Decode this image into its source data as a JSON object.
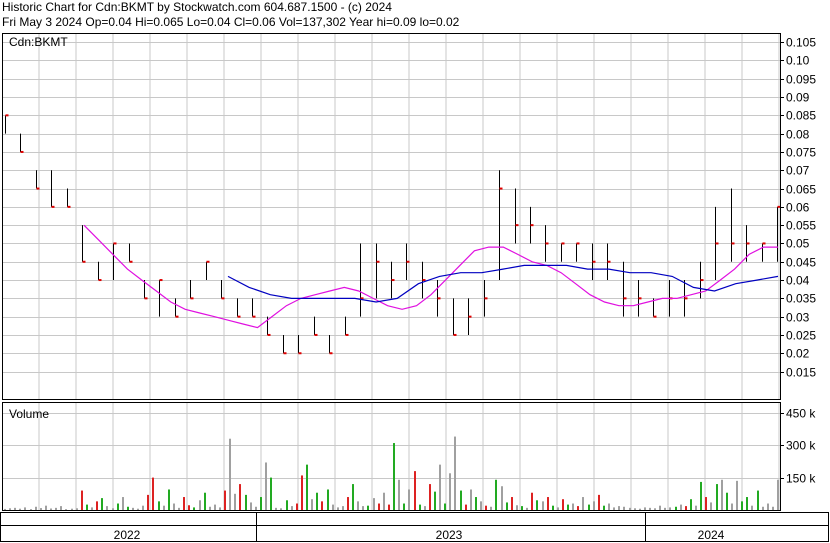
{
  "header": {
    "line1": "Historic Chart for Cdn:BKMT by Stockwatch.com 604.687.1500 - (c) 2024",
    "line2": "Fri May  3 2024   Op=0.04  Hi=0.065  Lo=0.04  Cl=0.06  Vol=137,302  Year hi=0.09  lo=0.02"
  },
  "chart_data": [
    {
      "type": "ohlc",
      "title": "Cdn:BKMT",
      "ylim": [
        0.0075,
        0.1075
      ],
      "y_ticks": [
        0.015,
        0.02,
        0.025,
        0.03,
        0.035,
        0.04,
        0.045,
        0.05,
        0.055,
        0.06,
        0.065,
        0.07,
        0.075,
        0.08,
        0.085,
        0.09,
        0.095,
        0.1,
        0.105
      ],
      "y_tick_labels": [
        "0.015",
        "0.02",
        "0.025",
        "0.03",
        "0.035",
        "0.04",
        "0.045",
        "0.05",
        "0.055",
        "0.06",
        "0.065",
        "0.07",
        "0.075",
        "0.08",
        "0.085",
        "0.09",
        "0.095",
        "0.10",
        "0.105"
      ],
      "grid": true,
      "colors": {
        "price_bar": "#000000",
        "close_tick": "#e00000",
        "ma_short": "#e010e0",
        "ma_long": "#0000c0",
        "grid": "#c8c8c8"
      },
      "bars_dense": [
        [
          0.08,
          0.085,
          0.08,
          0.085
        ],
        [
          0.08,
          0.08,
          0.075,
          0.075
        ],
        [
          0.07,
          0.07,
          0.065,
          0.065
        ],
        [
          0.07,
          0.07,
          0.06,
          0.06
        ],
        [
          0.065,
          0.065,
          0.06,
          0.06
        ],
        [
          0.06,
          0.065,
          0.06,
          0.06
        ],
        [
          0.055,
          0.055,
          0.045,
          0.045
        ],
        [
          0.045,
          0.045,
          0.04,
          0.04
        ],
        [
          0.04,
          0.05,
          0.04,
          0.05
        ],
        [
          0.05,
          0.05,
          0.045,
          0.045
        ],
        [
          0.04,
          0.04,
          0.035,
          0.035
        ],
        [
          0.035,
          0.04,
          0.03,
          0.04
        ],
        [
          0.03,
          0.035,
          0.03,
          0.03
        ],
        [
          0.035,
          0.04,
          0.035,
          0.035
        ],
        [
          0.04,
          0.045,
          0.04,
          0.045
        ],
        [
          0.04,
          0.04,
          0.035,
          0.035
        ],
        [
          0.035,
          0.035,
          0.03,
          0.03
        ],
        [
          0.03,
          0.035,
          0.03,
          0.03
        ],
        [
          0.03,
          0.03,
          0.025,
          0.025
        ],
        [
          0.02,
          0.025,
          0.02,
          0.02
        ],
        [
          0.025,
          0.025,
          0.02,
          0.02
        ],
        [
          0.025,
          0.03,
          0.025,
          0.025
        ],
        [
          0.02,
          0.025,
          0.02,
          0.02
        ],
        [
          0.025,
          0.03,
          0.025,
          0.025
        ],
        [
          0.03,
          0.05,
          0.03,
          0.035
        ],
        [
          0.04,
          0.05,
          0.035,
          0.045
        ],
        [
          0.04,
          0.045,
          0.035,
          0.04
        ],
        [
          0.045,
          0.05,
          0.04,
          0.045
        ],
        [
          0.04,
          0.045,
          0.035,
          0.04
        ],
        [
          0.035,
          0.04,
          0.03,
          0.035
        ],
        [
          0.03,
          0.035,
          0.025,
          0.025
        ],
        [
          0.03,
          0.035,
          0.025,
          0.03
        ],
        [
          0.035,
          0.04,
          0.03,
          0.035
        ],
        [
          0.04,
          0.07,
          0.04,
          0.065
        ],
        [
          0.06,
          0.065,
          0.05,
          0.055
        ],
        [
          0.055,
          0.06,
          0.05,
          0.055
        ],
        [
          0.05,
          0.055,
          0.045,
          0.05
        ],
        [
          0.045,
          0.05,
          0.045,
          0.05
        ],
        [
          0.05,
          0.05,
          0.045,
          0.05
        ],
        [
          0.045,
          0.05,
          0.04,
          0.045
        ],
        [
          0.045,
          0.05,
          0.04,
          0.045
        ],
        [
          0.04,
          0.045,
          0.03,
          0.035
        ],
        [
          0.035,
          0.04,
          0.03,
          0.035
        ],
        [
          0.03,
          0.035,
          0.03,
          0.03
        ],
        [
          0.035,
          0.04,
          0.03,
          0.035
        ],
        [
          0.035,
          0.04,
          0.03,
          0.035
        ],
        [
          0.04,
          0.045,
          0.035,
          0.04
        ],
        [
          0.045,
          0.06,
          0.04,
          0.05
        ],
        [
          0.05,
          0.065,
          0.045,
          0.05
        ],
        [
          0.05,
          0.055,
          0.045,
          0.05
        ],
        [
          0.045,
          0.05,
          0.045,
          0.05
        ],
        [
          0.05,
          0.06,
          0.045,
          0.06
        ]
      ],
      "bars": [
        [
          0.08,
          0.085,
          0.08,
          0.085
        ],
        [
          0.08,
          0.08,
          0.075,
          0.075
        ],
        [
          0.07,
          0.07,
          0.065,
          0.065
        ],
        [
          0.07,
          0.07,
          0.06,
          0.06
        ],
        [
          0.065,
          0.065,
          0.06,
          0.06
        ],
        [
          0.055,
          0.055,
          0.045,
          0.045
        ],
        [
          0.045,
          0.045,
          0.04,
          0.04
        ],
        [
          0.04,
          0.05,
          0.04,
          0.05
        ],
        [
          0.05,
          0.05,
          0.045,
          0.045
        ],
        [
          0.04,
          0.04,
          0.035,
          0.035
        ],
        [
          0.035,
          0.04,
          0.03,
          0.04
        ],
        [
          0.03,
          0.035,
          0.03,
          0.03
        ],
        [
          0.035,
          0.04,
          0.035,
          0.035
        ],
        [
          0.04,
          0.045,
          0.04,
          0.045
        ],
        [
          0.04,
          0.04,
          0.035,
          0.035
        ],
        [
          0.035,
          0.035,
          0.03,
          0.03
        ],
        [
          0.03,
          0.035,
          0.03,
          0.03
        ],
        [
          0.03,
          0.03,
          0.025,
          0.025
        ],
        [
          0.02,
          0.025,
          0.02,
          0.02
        ],
        [
          0.025,
          0.025,
          0.02,
          0.02
        ],
        [
          0.025,
          0.03,
          0.025,
          0.025
        ],
        [
          0.02,
          0.025,
          0.02,
          0.02
        ],
        [
          0.025,
          0.03,
          0.025,
          0.025
        ],
        [
          0.03,
          0.05,
          0.03,
          0.035
        ],
        [
          0.04,
          0.05,
          0.035,
          0.045
        ],
        [
          0.04,
          0.045,
          0.035,
          0.04
        ],
        [
          0.045,
          0.05,
          0.04,
          0.045
        ],
        [
          0.04,
          0.045,
          0.035,
          0.04
        ],
        [
          0.035,
          0.04,
          0.03,
          0.035
        ],
        [
          0.03,
          0.035,
          0.025,
          0.025
        ],
        [
          0.03,
          0.035,
          0.025,
          0.03
        ],
        [
          0.035,
          0.04,
          0.03,
          0.035
        ],
        [
          0.04,
          0.07,
          0.04,
          0.065
        ],
        [
          0.06,
          0.065,
          0.05,
          0.055
        ],
        [
          0.055,
          0.06,
          0.05,
          0.055
        ],
        [
          0.05,
          0.055,
          0.045,
          0.05
        ],
        [
          0.045,
          0.05,
          0.045,
          0.05
        ],
        [
          0.05,
          0.05,
          0.045,
          0.05
        ],
        [
          0.045,
          0.05,
          0.04,
          0.045
        ],
        [
          0.045,
          0.05,
          0.04,
          0.045
        ],
        [
          0.04,
          0.045,
          0.03,
          0.035
        ],
        [
          0.035,
          0.04,
          0.03,
          0.035
        ],
        [
          0.03,
          0.035,
          0.03,
          0.03
        ],
        [
          0.035,
          0.04,
          0.03,
          0.035
        ],
        [
          0.035,
          0.04,
          0.03,
          0.035
        ],
        [
          0.04,
          0.045,
          0.035,
          0.04
        ],
        [
          0.045,
          0.06,
          0.04,
          0.05
        ],
        [
          0.05,
          0.065,
          0.045,
          0.05
        ],
        [
          0.05,
          0.055,
          0.045,
          0.05
        ],
        [
          0.045,
          0.05,
          0.045,
          0.05
        ],
        [
          0.05,
          0.06,
          0.045,
          0.06
        ]
      ],
      "ma_short": [
        0.055,
        0.051,
        0.047,
        0.043,
        0.04,
        0.037,
        0.034,
        0.032,
        0.031,
        0.03,
        0.029,
        0.028,
        0.027,
        0.03,
        0.033,
        0.035,
        0.036,
        0.037,
        0.038,
        0.037,
        0.035,
        0.033,
        0.032,
        0.033,
        0.036,
        0.04,
        0.044,
        0.048,
        0.049,
        0.049,
        0.047,
        0.045,
        0.044,
        0.042,
        0.039,
        0.036,
        0.034,
        0.033,
        0.033,
        0.034,
        0.035,
        0.035,
        0.036,
        0.037,
        0.04,
        0.043,
        0.047,
        0.049,
        0.049
      ],
      "ma_long": [
        0.041,
        0.038,
        0.036,
        0.035,
        0.035,
        0.035,
        0.035,
        0.034,
        0.035,
        0.039,
        0.041,
        0.042,
        0.042,
        0.043,
        0.044,
        0.044,
        0.044,
        0.043,
        0.043,
        0.042,
        0.042,
        0.041,
        0.038,
        0.037,
        0.039,
        0.04,
        0.041
      ]
    },
    {
      "type": "bar",
      "title": "Volume",
      "ylim": [
        0,
        500
      ],
      "y_ticks": [
        150,
        300,
        450
      ],
      "y_tick_labels": [
        "150 k",
        "300 k",
        "450 k"
      ],
      "colors": {
        "up": "#22aa22",
        "down": "#dd2222",
        "flat": "#a0a0a0"
      },
      "values": [
        5,
        8,
        10,
        6,
        12,
        4,
        15,
        9,
        20,
        7,
        10,
        18,
        4,
        6,
        8,
        90,
        25,
        12,
        40,
        55,
        18,
        8,
        30,
        60,
        15,
        10,
        6,
        20,
        70,
        150,
        40,
        20,
        95,
        30,
        10,
        60,
        22,
        12,
        45,
        80,
        15,
        25,
        12,
        90,
        330,
        75,
        120,
        70,
        35,
        15,
        60,
        220,
        150,
        10,
        8,
        45,
        18,
        30,
        160,
        210,
        50,
        80,
        40,
        95,
        25,
        12,
        18,
        60,
        120,
        40,
        18,
        20,
        55,
        30,
        80,
        25,
        310,
        140,
        30,
        95,
        180,
        25,
        18,
        120,
        85,
        210,
        30,
        170,
        340,
        90,
        25,
        95,
        60,
        40,
        20,
        15,
        140,
        110,
        35,
        60,
        22,
        18,
        10,
        80,
        45,
        40,
        60,
        20,
        12,
        50,
        25,
        30,
        18,
        60,
        25,
        40,
        70,
        20,
        30,
        12,
        18,
        15,
        10,
        8,
        6,
        12,
        10,
        8,
        20,
        10,
        12,
        15,
        25,
        18,
        50,
        20,
        130,
        60,
        35,
        120,
        140,
        80,
        30,
        135,
        40,
        60,
        20,
        90,
        15,
        30,
        15,
        140
      ],
      "types": [
        "f",
        "f",
        "f",
        "f",
        "f",
        "f",
        "f",
        "f",
        "f",
        "f",
        "f",
        "f",
        "f",
        "f",
        "f",
        "d",
        "u",
        "f",
        "d",
        "u",
        "f",
        "f",
        "u",
        "f",
        "u",
        "f",
        "f",
        "f",
        "d",
        "d",
        "u",
        "f",
        "u",
        "f",
        "f",
        "d",
        "d",
        "u",
        "f",
        "u",
        "f",
        "f",
        "f",
        "d",
        "f",
        "f",
        "d",
        "u",
        "f",
        "f",
        "u",
        "f",
        "u",
        "f",
        "f",
        "u",
        "f",
        "d",
        "d",
        "u",
        "f",
        "u",
        "d",
        "u",
        "f",
        "f",
        "f",
        "d",
        "u",
        "f",
        "f",
        "u",
        "f",
        "d",
        "f",
        "d",
        "u",
        "f",
        "u",
        "f",
        "d",
        "u",
        "f",
        "d",
        "u",
        "f",
        "u",
        "f",
        "f",
        "u",
        "d",
        "f",
        "u",
        "f",
        "d",
        "f",
        "u",
        "f",
        "u",
        "d",
        "f",
        "u",
        "f",
        "d",
        "u",
        "f",
        "d",
        "u",
        "f",
        "d",
        "u",
        "f",
        "d",
        "f",
        "u",
        "f",
        "d",
        "u",
        "f",
        "f",
        "f",
        "f",
        "f",
        "f",
        "f",
        "f",
        "f",
        "f",
        "f",
        "f",
        "f",
        "u",
        "f",
        "d",
        "u",
        "f",
        "u",
        "d",
        "f",
        "u",
        "f",
        "u",
        "f",
        "f",
        "u",
        "u",
        "f",
        "u"
      ]
    }
  ],
  "labels": {
    "symbol": "Cdn:BKMT",
    "volume_title": "Volume",
    "years": [
      "2022",
      "2023",
      "2024"
    ]
  }
}
